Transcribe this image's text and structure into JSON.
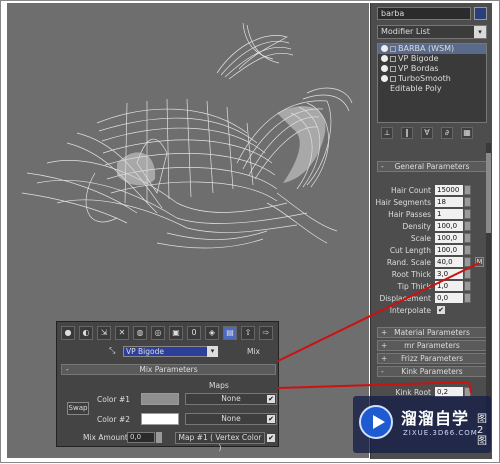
{
  "object_name": "barba",
  "modifier_list": {
    "label": "Modifier List",
    "arrow": "▾"
  },
  "modifier_stack": [
    {
      "label": "BARBA (WSM)",
      "selected": true
    },
    {
      "label": "VP Bigode",
      "selected": false
    },
    {
      "label": "VP Bordas",
      "selected": false
    },
    {
      "label": "TurboSmooth",
      "selected": false
    },
    {
      "label": "Editable Poly",
      "selected": false,
      "base": true
    }
  ],
  "stack_tools": [
    "pin-icon",
    "show-end-icon",
    "make-unique-icon",
    "remove-modifier-icon",
    "configure-icon"
  ],
  "rollouts": {
    "general": "General Parameters",
    "material": "Material Parameters",
    "mr": "mr Parameters",
    "frizz": "Frizz Parameters",
    "kink": "Kink Parameters",
    "plus": "+",
    "minus": "-"
  },
  "params": [
    {
      "label": "Hair Count",
      "value": "15000"
    },
    {
      "label": "Hair Segments",
      "value": "18"
    },
    {
      "label": "Hair Passes",
      "value": "1"
    },
    {
      "label": "Density",
      "value": "100,0"
    },
    {
      "label": "Scale",
      "value": "100,0"
    },
    {
      "label": "Cut Length",
      "value": "100,0"
    },
    {
      "label": "Rand. Scale",
      "value": "40,0",
      "m": "M"
    },
    {
      "label": "Root Thick",
      "value": "3,0"
    },
    {
      "label": "Tip Thick",
      "value": "1,0"
    },
    {
      "label": "Displacement",
      "value": "0,0"
    }
  ],
  "interpolate": {
    "label": "Interpolate",
    "checked": "✔"
  },
  "kink_root": {
    "label": "Kink Root",
    "value": "0,2"
  },
  "material_editor": {
    "material_name": "VP Bigode",
    "mix_label": "Mix",
    "rollout_title": "Mix Parameters",
    "minus": "-",
    "maps_header": "Maps",
    "swap_label": "Swap",
    "color1_label": "Color #1",
    "color2_label": "Color #2",
    "color1_value": "#8f8f8f",
    "color2_value": "#ffffff",
    "map1": "None",
    "map2": "None",
    "mix_amount_label": "Mix Amount",
    "mix_amount_value": "0,0",
    "mix_map": "Map #1 ( Vertex Color )",
    "check": "✔",
    "picker": "⤡"
  },
  "watermark": {
    "title": "溜溜自学",
    "subtitle": "ZIXUE.3D66.COM",
    "side": "图 2 图"
  },
  "colors": {
    "viewport": "#6e6e6e",
    "panel": "#4d4d4d",
    "annotation": "#cc1111"
  }
}
